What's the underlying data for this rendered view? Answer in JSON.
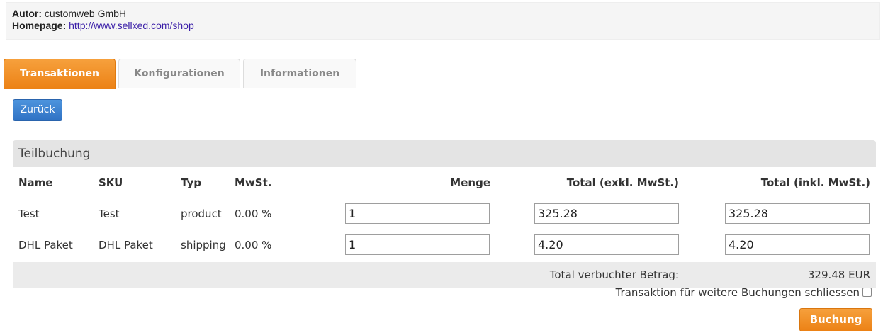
{
  "meta": {
    "author_label": "Autor:",
    "author_value": "customweb GmbH",
    "homepage_label": "Homepage:",
    "homepage_url": "http://www.sellxed.com/shop"
  },
  "tabs": [
    {
      "label": "Transaktionen",
      "active": true
    },
    {
      "label": "Konfigurationen",
      "active": false
    },
    {
      "label": "Informationen",
      "active": false
    }
  ],
  "back_button": "Zurück",
  "panel": {
    "title": "Teilbuchung",
    "headers": {
      "name": "Name",
      "sku": "SKU",
      "type": "Typ",
      "vat": "MwSt.",
      "qty": "Menge",
      "total_excl": "Total (exkl. MwSt.)",
      "total_incl": "Total (inkl. MwSt.)"
    },
    "rows": [
      {
        "name": "Test",
        "sku": "Test",
        "type": "product",
        "vat": "0.00 %",
        "qty": "1",
        "total_excl": "325.28",
        "total_incl": "325.28"
      },
      {
        "name": "DHL Paket",
        "sku": "DHL Paket",
        "type": "shipping",
        "vat": "0.00 %",
        "qty": "1",
        "total_excl": "4.20",
        "total_incl": "4.20"
      }
    ],
    "total_label": "Total verbuchter Betrag:",
    "total_value": "329.48 EUR"
  },
  "close_transaction_label": "Transaktion für weitere Buchungen schliessen",
  "close_transaction_checked": false,
  "submit_button": "Buchung"
}
